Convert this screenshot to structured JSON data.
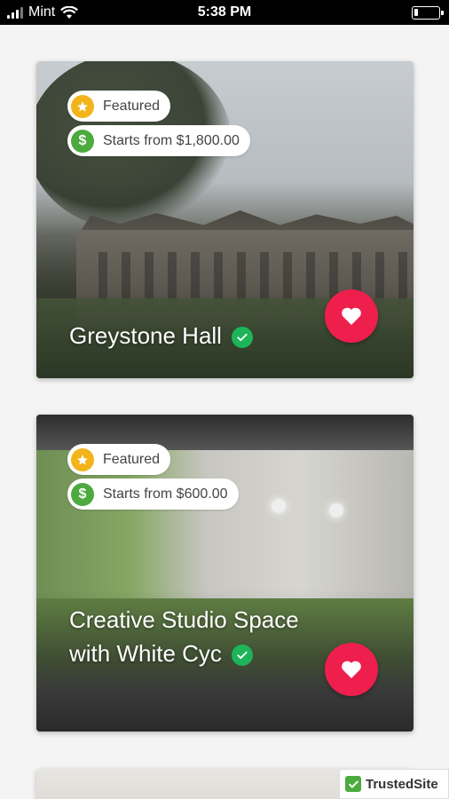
{
  "status_bar": {
    "carrier": "Mint",
    "time": "5:38 PM"
  },
  "colors": {
    "favorite": "#ee1f4d",
    "featured_star": "#f3b41b",
    "price_dollar": "#4caa3e",
    "verified": "#1db45a"
  },
  "listings": [
    {
      "featured_label": "Featured",
      "price_label": "Starts from $1,800.00",
      "title": "Greystone Hall",
      "verified": true
    },
    {
      "featured_label": "Featured",
      "price_label": "Starts from $600.00",
      "title": "Creative Studio Space with White Cyc",
      "verified": true
    }
  ],
  "trusted_site": {
    "label": "TrustedSite"
  },
  "icons": {
    "star": "star-icon",
    "dollar": "dollar-icon",
    "verified": "verified-check-icon",
    "favorite": "heart-icon"
  }
}
